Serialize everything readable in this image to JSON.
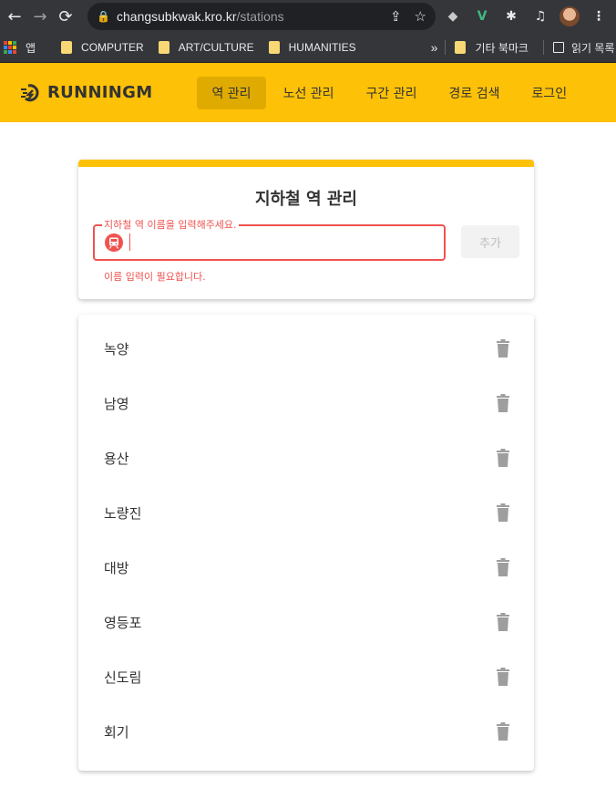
{
  "browser": {
    "url_host": "changsubkwak.kro.kr",
    "url_path": "/stations",
    "bookmarks": [
      {
        "label": "앱"
      },
      {
        "label": "COMPUTER"
      },
      {
        "label": "ART/CULTURE"
      },
      {
        "label": "HUMANITIES"
      }
    ],
    "more_bookmarks": "»",
    "other_bookmarks": "기타 북마크",
    "reading_list": "읽기 목록"
  },
  "header": {
    "logo": "RUNNINGM",
    "menu": [
      {
        "label": "역 관리",
        "active": true
      },
      {
        "label": "노선 관리",
        "active": false
      },
      {
        "label": "구간 관리",
        "active": false
      },
      {
        "label": "경로 검색",
        "active": false
      },
      {
        "label": "로그인",
        "active": false
      }
    ]
  },
  "form": {
    "title": "지하철 역 관리",
    "input_label": "지하철 역 이름을 입력해주세요.",
    "input_value": "",
    "error": "이름 입력이 필요합니다.",
    "add_button": "추가"
  },
  "stations": [
    "녹양",
    "남영",
    "용산",
    "노량진",
    "대방",
    "영등포",
    "신도림",
    "회기"
  ],
  "colors": {
    "accent": "#fdc107",
    "active_menu": "#e0ab00",
    "error": "#ef5350"
  }
}
